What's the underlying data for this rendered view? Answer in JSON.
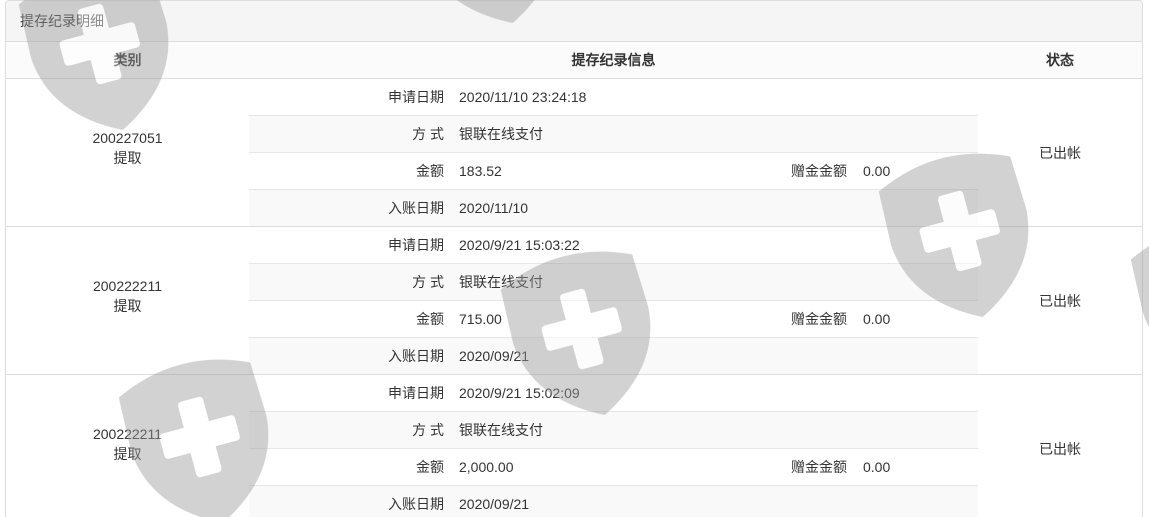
{
  "panel": {
    "title": "提存纪录明细"
  },
  "columns": {
    "category": "类别",
    "info": "提存纪录信息",
    "status": "状态"
  },
  "labels": {
    "apply_date": "申请日期",
    "method": "方 式",
    "amount": "金额",
    "bonus": "赠金金额",
    "posted_date": "入账日期"
  },
  "records": [
    {
      "id": "200227051",
      "type": "提取",
      "apply_date": "2020/11/10 23:24:18",
      "method": "银联在线支付",
      "amount": "183.52",
      "bonus": "0.00",
      "posted_date": "2020/11/10",
      "status": "已出帐"
    },
    {
      "id": "200222211",
      "type": "提取",
      "apply_date": "2020/9/21 15:03:22",
      "method": "银联在线支付",
      "amount": "715.00",
      "bonus": "0.00",
      "posted_date": "2020/09/21",
      "status": "已出帐"
    },
    {
      "id": "200222211",
      "type": "提取",
      "apply_date": "2020/9/21 15:02:09",
      "method": "银联在线支付",
      "amount": "2,000.00",
      "bonus": "0.00",
      "posted_date": "2020/09/21",
      "status": "已出帐"
    }
  ],
  "colors": {
    "text": "#333333",
    "border": "#dddddd",
    "heading_bg": "#f5f5f5",
    "stripe_bg": "#f9f9f9"
  },
  "icons": {
    "watermark": "shield-cross-icon"
  }
}
